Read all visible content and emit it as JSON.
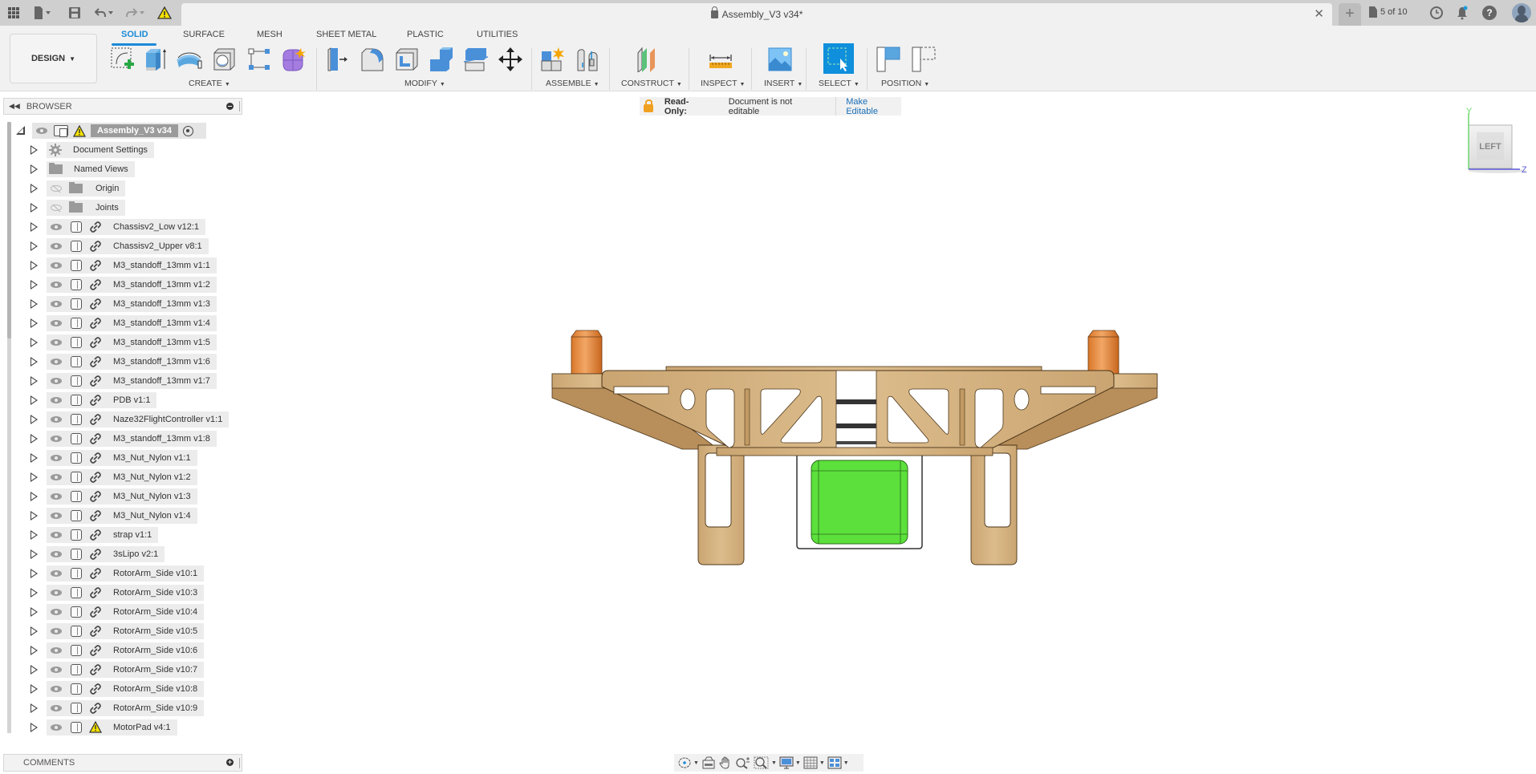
{
  "titlebar": {
    "document_title": "Assembly_V3 v34*",
    "jobs_status": "5 of 10",
    "icons": [
      "apps-grid-icon",
      "file-menu-icon",
      "save-icon",
      "undo-icon",
      "redo-icon",
      "warning-icon",
      "close-tab-icon",
      "new-tab-icon",
      "job-status-icon",
      "clock-icon",
      "notification-bell-icon",
      "help-icon",
      "user-avatar"
    ]
  },
  "toolbar": {
    "workspace_button": "DESIGN",
    "tabs": [
      {
        "label": "SOLID",
        "active": true
      },
      {
        "label": "SURFACE",
        "active": false
      },
      {
        "label": "MESH",
        "active": false
      },
      {
        "label": "SHEET METAL",
        "active": false
      },
      {
        "label": "PLASTIC",
        "active": false
      },
      {
        "label": "UTILITIES",
        "active": false
      }
    ],
    "groups": [
      {
        "label": "CREATE",
        "tools": [
          "create-sketch-icon",
          "extrude-icon",
          "revolve-icon",
          "hole-icon",
          "pattern-icon",
          "form-icon"
        ]
      },
      {
        "label": "MODIFY",
        "tools": [
          "press-pull-icon",
          "fillet-icon",
          "shell-icon",
          "combine-icon",
          "split-body-icon",
          "move-copy-icon"
        ]
      },
      {
        "label": "ASSEMBLE",
        "tools": [
          "new-component-icon",
          "joint-icon"
        ]
      },
      {
        "label": "CONSTRUCT",
        "tools": [
          "offset-plane-icon"
        ]
      },
      {
        "label": "INSPECT",
        "tools": [
          "measure-icon"
        ]
      },
      {
        "label": "INSERT",
        "tools": [
          "insert-image-icon"
        ]
      },
      {
        "label": "SELECT",
        "tools": [
          "window-select-icon"
        ]
      },
      {
        "label": "POSITION",
        "tools": [
          "capture-position-icon",
          "revert-position-icon"
        ]
      }
    ]
  },
  "readonly_banner": {
    "label": "Read-Only:",
    "message": "Document is not editable",
    "action": "Make Editable"
  },
  "browser": {
    "title": "BROWSER",
    "root": {
      "name": "Assembly_V3 v34",
      "warning": true
    },
    "items": [
      {
        "label": "Document Settings",
        "type": "settings"
      },
      {
        "label": "Named Views",
        "type": "folder"
      },
      {
        "label": "Origin",
        "type": "folder",
        "hidden": true
      },
      {
        "label": "Joints",
        "type": "folder",
        "hidden": true
      },
      {
        "label": "Chassisv2_Low v12:1",
        "type": "component"
      },
      {
        "label": "Chassisv2_Upper v8:1",
        "type": "component"
      },
      {
        "label": "M3_standoff_13mm v1:1",
        "type": "component"
      },
      {
        "label": "M3_standoff_13mm v1:2",
        "type": "component"
      },
      {
        "label": "M3_standoff_13mm v1:3",
        "type": "component"
      },
      {
        "label": "M3_standoff_13mm v1:4",
        "type": "component"
      },
      {
        "label": "M3_standoff_13mm v1:5",
        "type": "component"
      },
      {
        "label": "M3_standoff_13mm v1:6",
        "type": "component"
      },
      {
        "label": "M3_standoff_13mm v1:7",
        "type": "component"
      },
      {
        "label": "PDB v1:1",
        "type": "component"
      },
      {
        "label": "Naze32FlightController v1:1",
        "type": "component"
      },
      {
        "label": "M3_standoff_13mm v1:8",
        "type": "component"
      },
      {
        "label": "M3_Nut_Nylon v1:1",
        "type": "component"
      },
      {
        "label": "M3_Nut_Nylon v1:2",
        "type": "component"
      },
      {
        "label": "M3_Nut_Nylon v1:3",
        "type": "component"
      },
      {
        "label": "M3_Nut_Nylon v1:4",
        "type": "component"
      },
      {
        "label": "strap v1:1",
        "type": "component"
      },
      {
        "label": "3sLipo v2:1",
        "type": "component"
      },
      {
        "label": "RotorArm_Side v10:1",
        "type": "component"
      },
      {
        "label": "RotorArm_Side v10:3",
        "type": "component"
      },
      {
        "label": "RotorArm_Side v10:4",
        "type": "component"
      },
      {
        "label": "RotorArm_Side v10:5",
        "type": "component"
      },
      {
        "label": "RotorArm_Side v10:6",
        "type": "component"
      },
      {
        "label": "RotorArm_Side v10:7",
        "type": "component"
      },
      {
        "label": "RotorArm_Side v10:8",
        "type": "component"
      },
      {
        "label": "RotorArm_Side v10:9",
        "type": "component"
      },
      {
        "label": "MotorPad v4:1",
        "type": "component",
        "warning": true
      }
    ]
  },
  "comments": {
    "title": "COMMENTS"
  },
  "viewcube": {
    "face": "LEFT",
    "axis_y": "Y",
    "axis_z": "Z"
  },
  "navbar": {
    "tools": [
      "orbit-icon",
      "look-at-icon",
      "pan-icon",
      "zoom-icon",
      "fit-icon",
      "display-settings-icon",
      "grid-icon",
      "viewports-icon"
    ]
  },
  "colors": {
    "accent": "#1a8ad8",
    "wood": "#d2ae7c",
    "standoff": "#e08a3c",
    "battery": "#5ce03c",
    "warning": "#f5e100"
  }
}
